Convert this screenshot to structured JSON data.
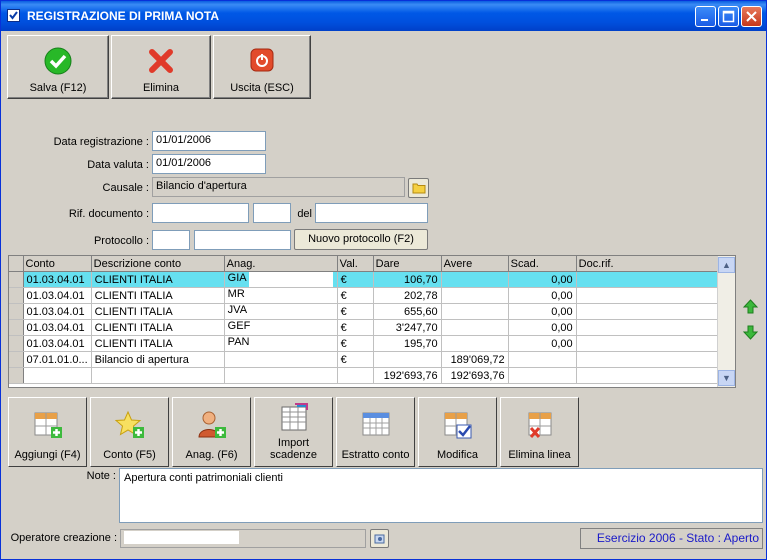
{
  "window": {
    "title": "REGISTRAZIONE DI PRIMA NOTA"
  },
  "toolbar": {
    "save_label": "Salva (F12)",
    "delete_label": "Elimina",
    "exit_label": "Uscita (ESC)"
  },
  "form": {
    "data_registrazione_label": "Data registrazione :",
    "data_registrazione_value": "01/01/2006",
    "data_valuta_label": "Data valuta :",
    "data_valuta_value": "01/01/2006",
    "causale_label": "Causale :",
    "causale_value": "Bilancio d'apertura",
    "rif_documento_label": "Rif. documento :",
    "del_label": "del",
    "protocollo_label": "Protocollo :",
    "nuovo_protocollo_button": "Nuovo protocollo (F2)"
  },
  "grid": {
    "headers": [
      "Conto",
      "Descrizione conto",
      "Anag.",
      "Val.",
      "Dare",
      "Avere",
      "Scad.",
      "Doc.rif."
    ],
    "rows": [
      {
        "conto": "01.03.04.01",
        "descrizione": "CLIENTI ITALIA",
        "anag": "GIA",
        "val": "€",
        "dare": "106,70",
        "avere": "",
        "scad": "0,00",
        "docrif": ""
      },
      {
        "conto": "01.03.04.01",
        "descrizione": "CLIENTI ITALIA",
        "anag": "MR",
        "val": "€",
        "dare": "202,78",
        "avere": "",
        "scad": "0,00",
        "docrif": ""
      },
      {
        "conto": "01.03.04.01",
        "descrizione": "CLIENTI ITALIA",
        "anag": "JVA",
        "val": "€",
        "dare": "655,60",
        "avere": "",
        "scad": "0,00",
        "docrif": ""
      },
      {
        "conto": "01.03.04.01",
        "descrizione": "CLIENTI ITALIA",
        "anag": "GEF",
        "val": "€",
        "dare": "3'247,70",
        "avere": "",
        "scad": "0,00",
        "docrif": ""
      },
      {
        "conto": "01.03.04.01",
        "descrizione": "CLIENTI ITALIA",
        "anag": "PAN",
        "val": "€",
        "dare": "195,70",
        "avere": "",
        "scad": "0,00",
        "docrif": ""
      },
      {
        "conto": "07.01.01.0...",
        "descrizione": "Bilancio di apertura",
        "anag": "",
        "val": "€",
        "dare": "",
        "avere": "189'069,72",
        "scad": "",
        "docrif": ""
      }
    ],
    "totals": {
      "dare": "192'693,76",
      "avere": "192'693,76"
    }
  },
  "actions": {
    "aggiungi": "Aggiungi (F4)",
    "conto": "Conto (F5)",
    "anag": "Anag. (F6)",
    "import_line1": "Import",
    "import_line2": "scadenze",
    "estratto": "Estratto conto",
    "modifica": "Modifica",
    "elimina_linea": "Elimina linea"
  },
  "note": {
    "label": "Note :",
    "value": "Apertura conti patrimoniali clienti"
  },
  "footer": {
    "operatore_label": "Operatore creazione :",
    "operatore_value": "",
    "status": "Esercizio 2006 - Stato : Aperto"
  }
}
